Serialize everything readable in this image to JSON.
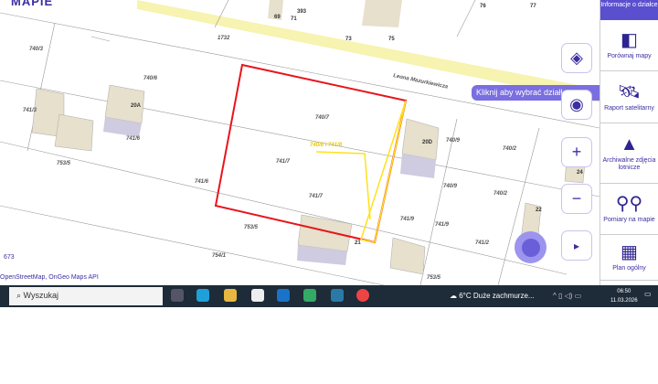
{
  "brand": "MAPIE",
  "map": {
    "labels": [
      "740/3",
      "740/6",
      "1732",
      "741/3",
      "741/6",
      "753/5",
      "741/6",
      "754/1",
      "740/7",
      "741/7",
      "741/7",
      "753/5",
      "740/9",
      "740/9",
      "741/9",
      "741/9",
      "740/2",
      "740/2",
      "741/2",
      "753/5",
      "Leona Mazurkiewicza",
      "740/8 i 741/8"
    ],
    "building_numbers": [
      "20A",
      "20D",
      "21",
      "22",
      "24",
      "69",
      "71",
      "73",
      "75",
      "77",
      "76",
      "393"
    ],
    "tooltip": "Kliknij aby wybrać działkę",
    "scale_text": "673",
    "attribution": "OpenStreetMap, OnGeo Maps API",
    "colors": {
      "selection": "#e8141c",
      "highlight": "#ffe11a",
      "road": "#f7f3b0",
      "building": "#e6e0cc",
      "accent": "#5a4fcf"
    }
  },
  "controls": {
    "layers": "layers-icon",
    "locate": "locate-icon",
    "zoom_in": "+",
    "zoom_out": "−",
    "expand": "▸"
  },
  "sidebar": {
    "top": "Informacje o działce",
    "items": [
      {
        "label": "Porównaj mapy",
        "icon": "compare-icon"
      },
      {
        "label": "Raport satelitarny",
        "icon": "satellite-icon"
      },
      {
        "label": "Archiwalne zdjęcia lotnicze",
        "icon": "photo-icon"
      },
      {
        "label": "Pomiary na mapie",
        "icon": "measure-icon"
      },
      {
        "label": "Plan ogólny",
        "icon": "plan-icon"
      }
    ]
  },
  "taskbar": {
    "search": "Wyszukaj",
    "weather": "6°C  Duże zachmurze...",
    "time": "06:50",
    "date": "11.03.2026"
  }
}
